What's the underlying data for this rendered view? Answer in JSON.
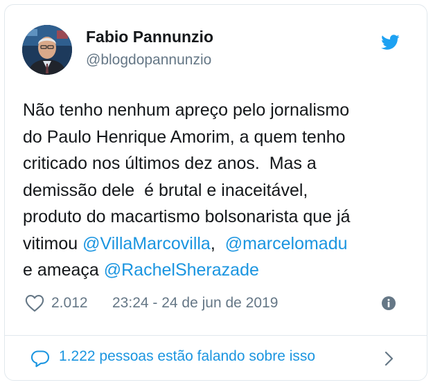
{
  "author": {
    "name": "Fabio Pannunzio",
    "handle": "@blogdopannunzio"
  },
  "tweet": {
    "lines": [
      [
        {
          "t": "Não tenho nenhum apreço pelo jornalismo"
        }
      ],
      [
        {
          "t": "do Paulo Henrique Amorim, a quem tenho"
        }
      ],
      [
        {
          "t": "criticado nos últimos dez anos.  Mas a"
        }
      ],
      [
        {
          "t": "demissão dele  é brutal e inaceitável,"
        }
      ],
      [
        {
          "t": "produto do macartismo bolsonarista que já"
        }
      ],
      [
        {
          "t": "vitimou "
        },
        {
          "t": "@VillaMarcovilla",
          "mention": true
        },
        {
          "t": ",  "
        },
        {
          "t": "@marcelomadu",
          "mention": true
        }
      ],
      [
        {
          "t": "e ameaça "
        },
        {
          "t": "@RachelSherazade",
          "mention": true
        }
      ]
    ]
  },
  "meta": {
    "likes": "2.012",
    "timestamp": "23:24 - 24 de jun de 2019"
  },
  "footer": {
    "talking_label": "1.222 pessoas estão falando sobre isso"
  },
  "icons": {
    "logo": "twitter-bird-icon",
    "like": "heart-outline-icon",
    "info": "info-circle-icon",
    "reply": "speech-bubble-icon",
    "more": "chevron-right-icon"
  },
  "colors": {
    "accent": "#1da1f2",
    "link": "#1b95e0",
    "text": "#14171a",
    "muted": "#657786",
    "border": "#e1e8ed"
  }
}
